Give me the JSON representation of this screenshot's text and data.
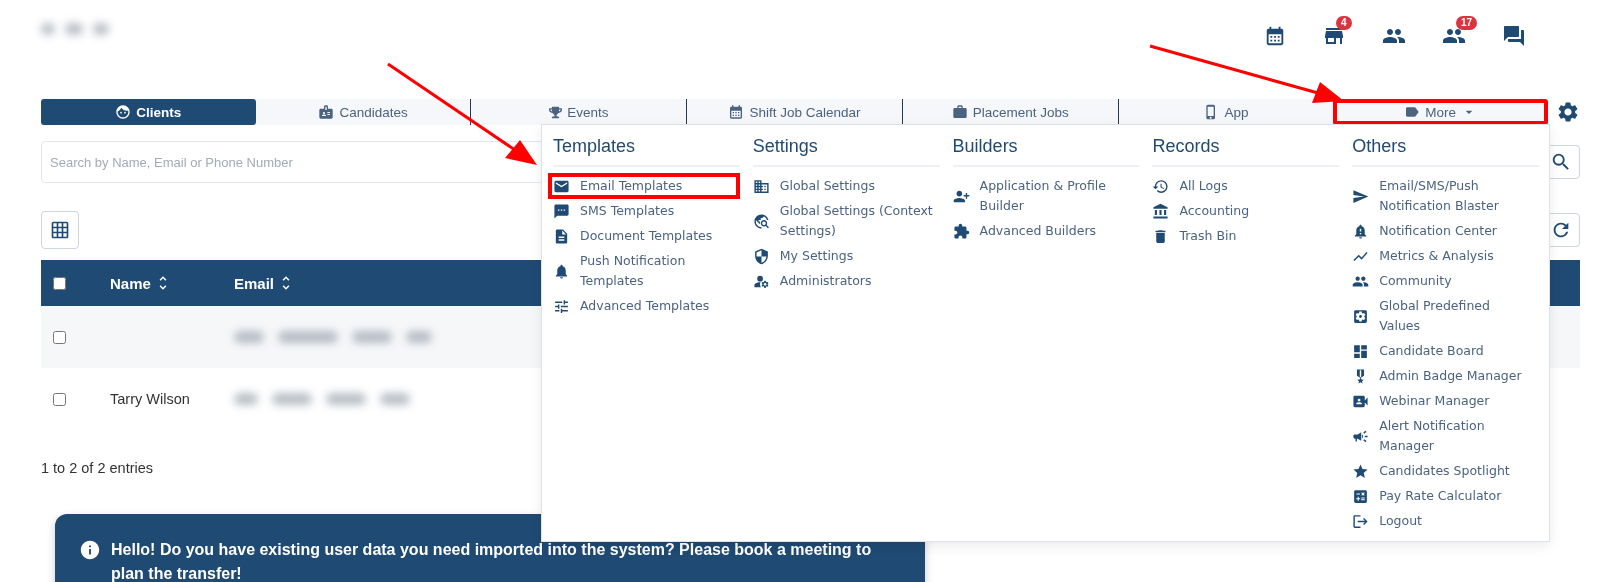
{
  "header": {
    "store_badge": "4",
    "team_badge": "17"
  },
  "tabs": [
    {
      "label": "Clients",
      "selected": true,
      "highlighted": false
    },
    {
      "label": "Candidates",
      "selected": false,
      "highlighted": false
    },
    {
      "label": "Events",
      "selected": false,
      "highlighted": false
    },
    {
      "label": "Shift Job Calendar",
      "selected": false,
      "highlighted": false
    },
    {
      "label": "Placement Jobs",
      "selected": false,
      "highlighted": false
    },
    {
      "label": "App",
      "selected": false,
      "highlighted": false
    },
    {
      "label": "More",
      "selected": false,
      "highlighted": true
    }
  ],
  "search": {
    "placeholder": "Search by Name, Email or Phone Number"
  },
  "table": {
    "select_all_checked": false,
    "columns": [
      {
        "label": "Name"
      },
      {
        "label": "Email"
      }
    ],
    "rows": [
      {
        "checked": false
      },
      {
        "name": "Tarry Wilson",
        "checked": false
      }
    ]
  },
  "entries": "1 to 2 of 2 entries",
  "banner": "Hello! Do you have existing user data you need imported into the system? Please book a meeting to plan the transfer!",
  "menu": [
    {
      "title": "Templates",
      "items": [
        {
          "label": "Email Templates",
          "highlighted": true
        },
        {
          "label": "SMS Templates",
          "highlighted": false
        },
        {
          "label": "Document Templates",
          "highlighted": false
        },
        {
          "label": "Push Notification Templates",
          "highlighted": false
        },
        {
          "label": "Advanced Templates",
          "highlighted": false
        }
      ]
    },
    {
      "title": "Settings",
      "items": [
        {
          "label": "Global Settings",
          "highlighted": false
        },
        {
          "label": "Global Settings (Context Settings)",
          "highlighted": false
        },
        {
          "label": "My Settings",
          "highlighted": false
        },
        {
          "label": "Administrators",
          "highlighted": false
        }
      ]
    },
    {
      "title": "Builders",
      "items": [
        {
          "label": "Application & Profile Builder",
          "highlighted": false
        },
        {
          "label": "Advanced Builders",
          "highlighted": false
        }
      ]
    },
    {
      "title": "Records",
      "items": [
        {
          "label": "All Logs",
          "highlighted": false
        },
        {
          "label": "Accounting",
          "highlighted": false
        },
        {
          "label": "Trash Bin",
          "highlighted": false
        }
      ]
    },
    {
      "title": "Others",
      "items": [
        {
          "label": "Email/SMS/Push Notification Blaster",
          "highlighted": false
        },
        {
          "label": "Notification Center",
          "highlighted": false
        },
        {
          "label": "Metrics & Analysis",
          "highlighted": false
        },
        {
          "label": "Community",
          "highlighted": false
        },
        {
          "label": "Global Predefined Values",
          "highlighted": false
        },
        {
          "label": "Candidate Board",
          "highlighted": false
        },
        {
          "label": "Admin Badge Manager",
          "highlighted": false
        },
        {
          "label": "Webinar Manager",
          "highlighted": false
        },
        {
          "label": "Alert Notification Manager",
          "highlighted": false
        },
        {
          "label": "Candidates Spotlight",
          "highlighted": false
        },
        {
          "label": "Pay Rate Calculator",
          "highlighted": false
        },
        {
          "label": "Logout",
          "highlighted": false
        }
      ]
    }
  ]
}
